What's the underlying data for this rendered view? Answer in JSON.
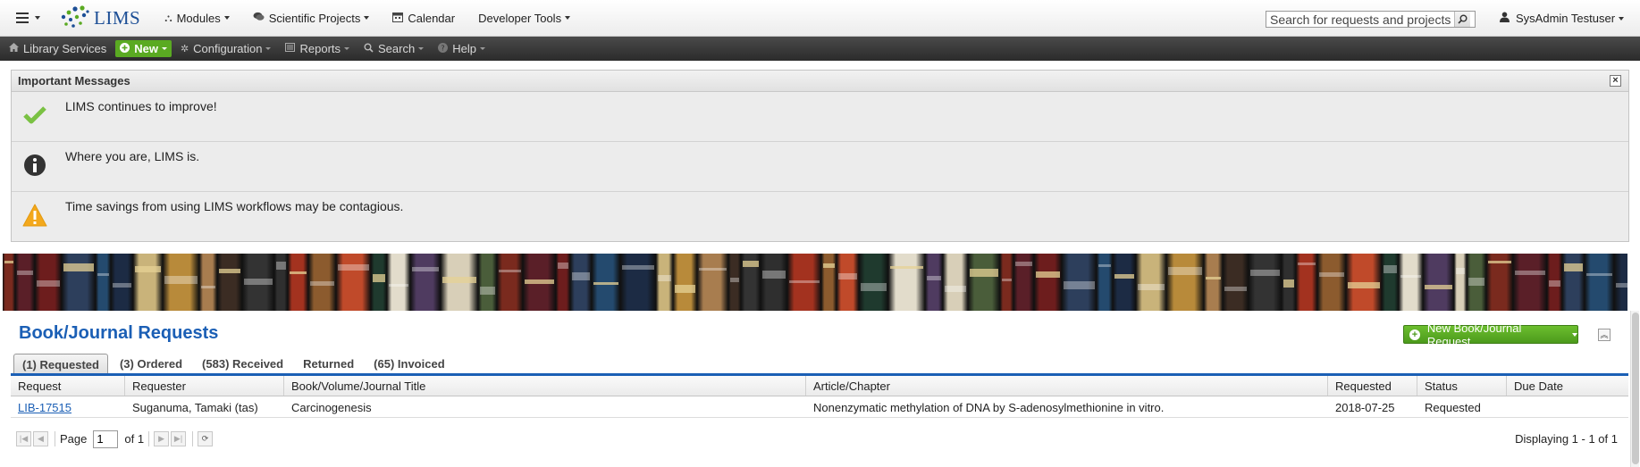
{
  "topbar": {
    "app_name": "LIMS",
    "menu": [
      {
        "label": "Modules",
        "icon": "sitemap-icon",
        "glyph": "⛬"
      },
      {
        "label": "Scientific Projects",
        "icon": "comments-icon",
        "glyph": "💬"
      },
      {
        "label": "Calendar",
        "icon": "calendar-icon",
        "glyph": "▦"
      },
      {
        "label": "Developer Tools",
        "icon": "",
        "glyph": ""
      }
    ],
    "search_placeholder": "Search for requests and projects",
    "user": "SysAdmin Testuser"
  },
  "subbar": {
    "items": [
      {
        "label": "Library Services",
        "icon": "home-icon"
      },
      {
        "label": "New",
        "icon": "plus-circle-icon"
      },
      {
        "label": "Configuration",
        "icon": "gear-icon"
      },
      {
        "label": "Reports",
        "icon": "list-icon"
      },
      {
        "label": "Search",
        "icon": "search-icon"
      },
      {
        "label": "Help",
        "icon": "question-icon"
      }
    ]
  },
  "messages": {
    "title": "Important Messages",
    "items": [
      {
        "type": "success",
        "icon": "check-icon",
        "text": "LIMS continues to improve!"
      },
      {
        "type": "info",
        "icon": "info-icon",
        "text": "Where you are, LIMS is."
      },
      {
        "type": "warning",
        "icon": "warning-icon",
        "text": "Time savings from using LIMS workflows may be contagious."
      }
    ]
  },
  "requests": {
    "title": "Book/Journal Requests",
    "new_button": "New Book/Journal Request",
    "tabs": [
      {
        "label": "(1) Requested",
        "active": true
      },
      {
        "label": "(3) Ordered",
        "active": false
      },
      {
        "label": "(583) Received",
        "active": false
      },
      {
        "label": "Returned",
        "active": false
      },
      {
        "label": "(65) Invoiced",
        "active": false
      }
    ],
    "columns": [
      "Request",
      "Requester",
      "Book/Volume/Journal Title",
      "Article/Chapter",
      "Requested",
      "Status",
      "Due Date"
    ],
    "rows": [
      [
        "LIB-17515",
        "Suganuma, Tamaki (tas)",
        "Carcinogenesis",
        "Nonenzymatic methylation of DNA by S-adenosylmethionine in vitro.",
        "2018-07-25",
        "Requested",
        ""
      ]
    ],
    "pager": {
      "page_label": "Page",
      "page_value": "1",
      "of_label": "of 1",
      "display_text": "Displaying 1 - 1 of 1"
    }
  },
  "colors": {
    "accent_blue": "#1b5fb5",
    "new_green": "#5aaa22",
    "dark_bar": "#2b2b2b",
    "success": "#7ac143",
    "warning": "#f3a81c",
    "info": "#333333"
  }
}
